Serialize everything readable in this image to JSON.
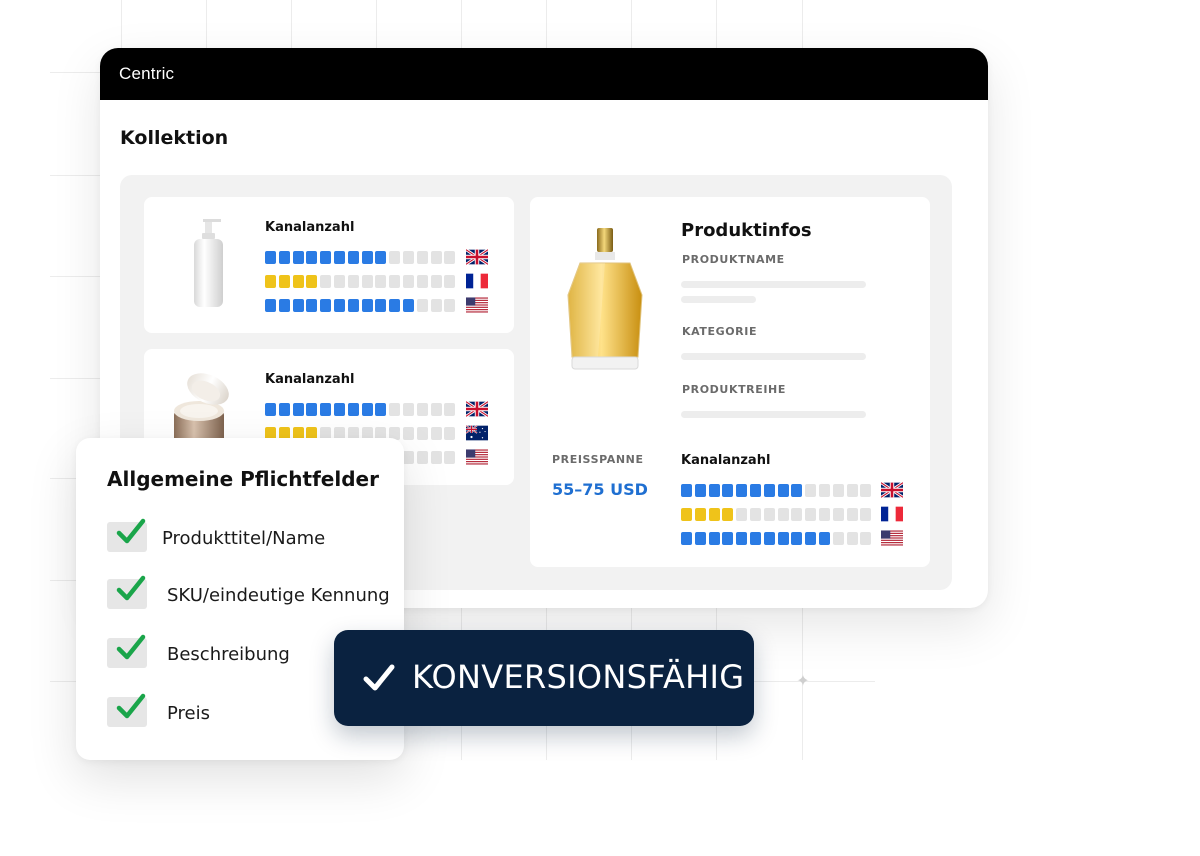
{
  "app": {
    "title": "Centric"
  },
  "page": {
    "title": "Kollektion"
  },
  "colors": {
    "blue_segment": "#2a7be4",
    "yellow_segment": "#efc31a",
    "empty_segment": "#e3e3e3",
    "price": "#1f6fd1",
    "badge_bg": "#0a2240",
    "check_green": "#1aa54a"
  },
  "cards": [
    {
      "image": "pump-bottle",
      "label": "Kanalanzahl",
      "rows": [
        {
          "flag": "uk-flag-icon",
          "filled": 9,
          "total": 14,
          "color": "blue"
        },
        {
          "flag": "france-flag-icon",
          "filled": 4,
          "total": 14,
          "color": "yellow"
        },
        {
          "flag": "usa-flag-icon",
          "filled": 11,
          "total": 14,
          "color": "blue"
        }
      ]
    },
    {
      "image": "cream-jar",
      "label": "Kanalanzahl",
      "rows": [
        {
          "flag": "uk-flag-icon",
          "filled": 9,
          "total": 14,
          "color": "blue"
        },
        {
          "flag": "australia-flag-icon",
          "filled": 4,
          "total": 14,
          "color": "yellow"
        },
        {
          "flag": "usa-flag-icon",
          "filled": 0,
          "total": 14,
          "color": "blue"
        }
      ]
    }
  ],
  "product_info": {
    "image": "perfume-bottle",
    "title": "Produktinfos",
    "fields": [
      "PRODUKTNAME",
      "KATEGORIE",
      "PRODUKTREIHE"
    ],
    "price_label": "PREISSPANNE",
    "price_value": "55–75 USD",
    "channels_label": "Kanalanzahl",
    "rows": [
      {
        "flag": "uk-flag-icon",
        "filled": 9,
        "total": 14,
        "color": "blue"
      },
      {
        "flag": "france-flag-icon",
        "filled": 4,
        "total": 14,
        "color": "yellow"
      },
      {
        "flag": "usa-flag-icon",
        "filled": 11,
        "total": 14,
        "color": "blue"
      }
    ]
  },
  "checklist": {
    "title": "Allgemeine Pflichtfelder",
    "items": [
      {
        "label": "Produkttitel/Name",
        "checked": true
      },
      {
        "label": "SKU/eindeutige Kennung",
        "checked": true
      },
      {
        "label": "Beschreibung",
        "checked": true
      },
      {
        "label": "Preis",
        "checked": true
      }
    ]
  },
  "badge": {
    "icon": "checkmark-icon",
    "label": "KONVERSIONSFÄHIG"
  }
}
